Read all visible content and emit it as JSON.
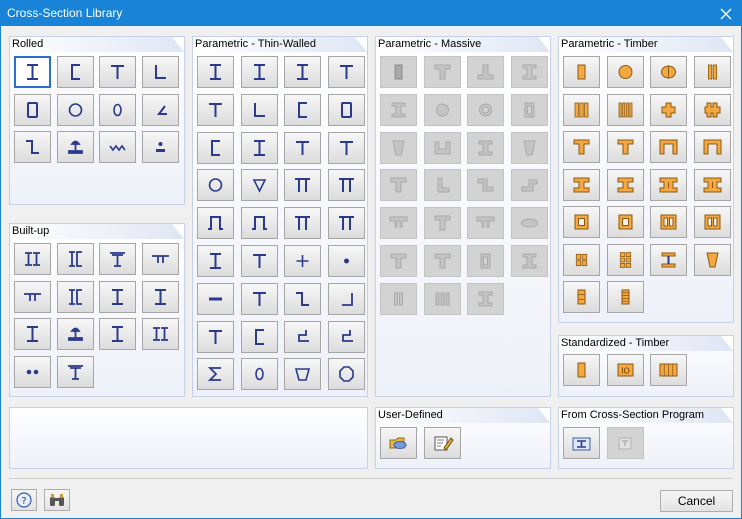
{
  "window": {
    "title": "Cross-Section Library"
  },
  "groups": {
    "rolled": "Rolled",
    "built_up": "Built-up",
    "thin_walled": "Parametric - Thin-Walled",
    "massive": "Parametric - Massive",
    "timber": "Parametric - Timber",
    "standardized_timber": "Standardized - Timber",
    "user_defined": "User-Defined",
    "from_program": "From Cross-Section Program"
  },
  "buttons": {
    "cancel": "Cancel"
  },
  "colors": {
    "titlebar": "#1883d7",
    "shape_blue": "#2b3a8c",
    "timber_orange": "#f5a742",
    "group_border": "#c6d1e7"
  },
  "icons": {
    "rolled": [
      "i-section-icon",
      "channel-icon",
      "t-section-icon",
      "angle-icon",
      "rectangular-hollow-icon",
      "circular-hollow-icon",
      "oval-hollow-icon",
      "unequal-angle-icon",
      "z-section-icon",
      "rail-icon",
      "sheet-pile-icon",
      "round-bar-icon"
    ],
    "built_up": [
      "double-i-icon",
      "double-channel-icon",
      "t-plate-icon",
      "double-angle-icon",
      "double-t-icon",
      "i-channel-icon",
      "i-t-icon",
      "plated-i-icon",
      "i-cover-icon",
      "rail-builtup-icon",
      "i-slotted-icon",
      "box-girder-icon",
      "double-round-icon",
      "t-builtup-icon"
    ],
    "thin_walled": [
      "tw-i-icon",
      "tw-i-unsym-icon",
      "tw-i-flange-icon",
      "tw-t-i-icon",
      "tw-t-icon",
      "tw-angle-icon",
      "tw-c-icon",
      "tw-rect-icon",
      "tw-channel-icon",
      "tw-i-var-icon",
      "tw-t-top-icon",
      "tw-y-icon",
      "tw-circle-icon",
      "tw-triangle-icon",
      "tw-pi-icon",
      "tw-pi-flange-icon",
      "tw-omega-icon",
      "tw-omega-lip-icon",
      "tw-pi-top-icon",
      "tw-pi-narrow-icon",
      "tw-cross-i-icon",
      "tw-cross-t-icon",
      "tw-plus-icon",
      "tw-dot-icon",
      "tw-flat-icon",
      "tw-t-inv-icon",
      "tw-z-icon",
      "tw-z-lip-icon",
      "tw-t-base-icon",
      "tw-c-lip-icon",
      "tw-hook-icon",
      "tw-hook-lip-icon",
      "tw-sigma-icon",
      "tw-ellipse-icon",
      "tw-trapezoid-icon",
      "tw-octagon-icon"
    ],
    "massive": [
      "m-rect-icon",
      "m-t-icon",
      "m-inv-t-icon",
      "m-i-icon",
      "m-i-taper-icon",
      "m-circle-icon",
      "m-ring-icon",
      "m-rect-hollow-icon",
      "m-trapezoid-icon",
      "m-u-icon",
      "m-i-var-icon",
      "m-t-var-icon",
      "m-t-haunch-icon",
      "m-l-icon",
      "m-z-icon",
      "m-step-icon",
      "m-double-t-icon",
      "m-t-wide-icon",
      "m-double-t-narrow-icon",
      "m-ellipse-icon",
      "m-t-slab-icon",
      "m-t-slab-2-icon",
      "m-hollow-box-icon",
      "m-i-double-icon",
      "m-double-rect-icon",
      "m-triple-rect-icon",
      "m-i-cap-icon"
    ],
    "timber": [
      "timber-rect-icon",
      "timber-circle-icon",
      "timber-round-cut-icon",
      "timber-double-rect-icon",
      "timber-triple-rect-icon",
      "timber-quad-rect-icon",
      "timber-cross-icon",
      "timber-double-cross-icon",
      "timber-t-icon",
      "timber-t-narrow-icon",
      "timber-pi-icon",
      "timber-pi-narrow-icon",
      "timber-i-icon",
      "timber-i-narrow-icon",
      "timber-double-i-icon",
      "timber-double-i-narrow-icon",
      "timber-box-icon",
      "timber-box-narrow-icon",
      "timber-double-box-icon",
      "timber-double-box-wide-icon",
      "timber-grid-4-icon",
      "timber-grid-6-icon",
      "timber-i-web-icon",
      "timber-trapezoid-icon",
      "timber-layered-3-icon",
      "timber-layered-5-icon"
    ],
    "standardized_timber": [
      "std-timber-rect-icon",
      "std-timber-io-icon",
      "std-timber-layered-icon"
    ],
    "user_defined": [
      "open-folder-icon",
      "edit-section-icon"
    ],
    "from_program": [
      "section-program-icon",
      "section-program-2-icon"
    ]
  }
}
